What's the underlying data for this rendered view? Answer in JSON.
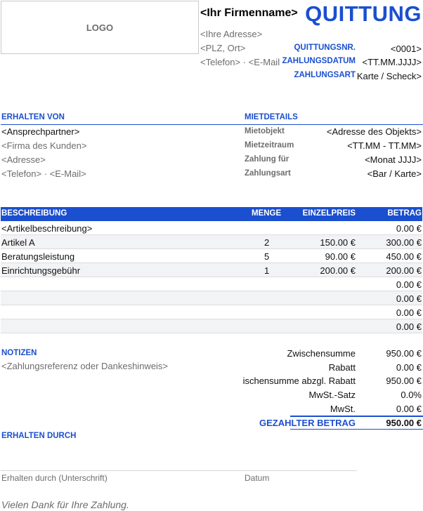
{
  "header": {
    "logo": "LOGO",
    "company_name": "<Ihr Firmenname>",
    "title": "QUITTUNG",
    "address": "<Ihre Adresse>",
    "zip_city": "<PLZ, Ort>",
    "contact": "<Telefon>  ·  <E-Mail>"
  },
  "meta": [
    {
      "label": "QUITTUNGSNR.",
      "value": "<0001>"
    },
    {
      "label": "ZAHLUNGSDATUM",
      "value": "<TT.MM.JJJJ>"
    },
    {
      "label": "ZAHLUNGSART",
      "value": "Karte / Scheck>"
    }
  ],
  "received_from": {
    "heading": "ERHALTEN VON",
    "lines": [
      "<Ansprechpartner>",
      "<Firma des Kunden>",
      "<Adresse>",
      "<Telefon>  ·  <E-Mail>"
    ]
  },
  "rental": {
    "heading": "MIETDETAILS",
    "rows": [
      {
        "label": "Mietobjekt",
        "value": "<Adresse des Objekts>"
      },
      {
        "label": "Mietzeitraum",
        "value": "<TT.MM - TT.MM>"
      },
      {
        "label": "Zahlung für",
        "value": "<Monat JJJJ>"
      },
      {
        "label": "Zahlungsart",
        "value": "<Bar / Karte>"
      }
    ]
  },
  "items": {
    "columns": {
      "desc": "BESCHREIBUNG",
      "qty": "MENGE",
      "unit": "EINZELPREIS",
      "amount": "BETRAG"
    },
    "rows": [
      {
        "desc": "<Artikelbeschreibung>",
        "qty": "",
        "unit": "",
        "amount": "0.00 €"
      },
      {
        "desc": "Artikel A",
        "qty": "2",
        "unit": "150.00 €",
        "amount": "300.00 €"
      },
      {
        "desc": "Beratungsleistung",
        "qty": "5",
        "unit": "90.00 €",
        "amount": "450.00 €"
      },
      {
        "desc": "Einrichtungsgebühr",
        "qty": "1",
        "unit": "200.00 €",
        "amount": "200.00 €"
      },
      {
        "desc": "",
        "qty": "",
        "unit": "",
        "amount": "0.00 €"
      },
      {
        "desc": "",
        "qty": "",
        "unit": "",
        "amount": "0.00 €"
      },
      {
        "desc": "",
        "qty": "",
        "unit": "",
        "amount": "0.00 €"
      },
      {
        "desc": "",
        "qty": "",
        "unit": "",
        "amount": "0.00 €"
      }
    ]
  },
  "notes": {
    "heading": "NOTIZEN",
    "text": "<Zahlungsreferenz oder Dankeshinweis>"
  },
  "totals": [
    {
      "label": "Zwischensumme",
      "value": "950.00 €"
    },
    {
      "label": "Rabatt",
      "value": "0.00 €"
    },
    {
      "label": "Zwischensumme abzgl. Rabatt",
      "value": "950.00 €"
    },
    {
      "label": "MwSt.-Satz",
      "value": "0.0%"
    },
    {
      "label": "MwSt.",
      "value": "0.00 €"
    }
  ],
  "grand_total": {
    "label": "GEZAHLTER BETRAG",
    "value": "950.00 €"
  },
  "received_by": {
    "heading": "ERHALTEN DURCH",
    "signature_label": "Erhalten durch (Unterschrift)",
    "date_label": "Datum"
  },
  "footer": {
    "thanks": "Vielen Dank für Ihre Zahlung."
  }
}
